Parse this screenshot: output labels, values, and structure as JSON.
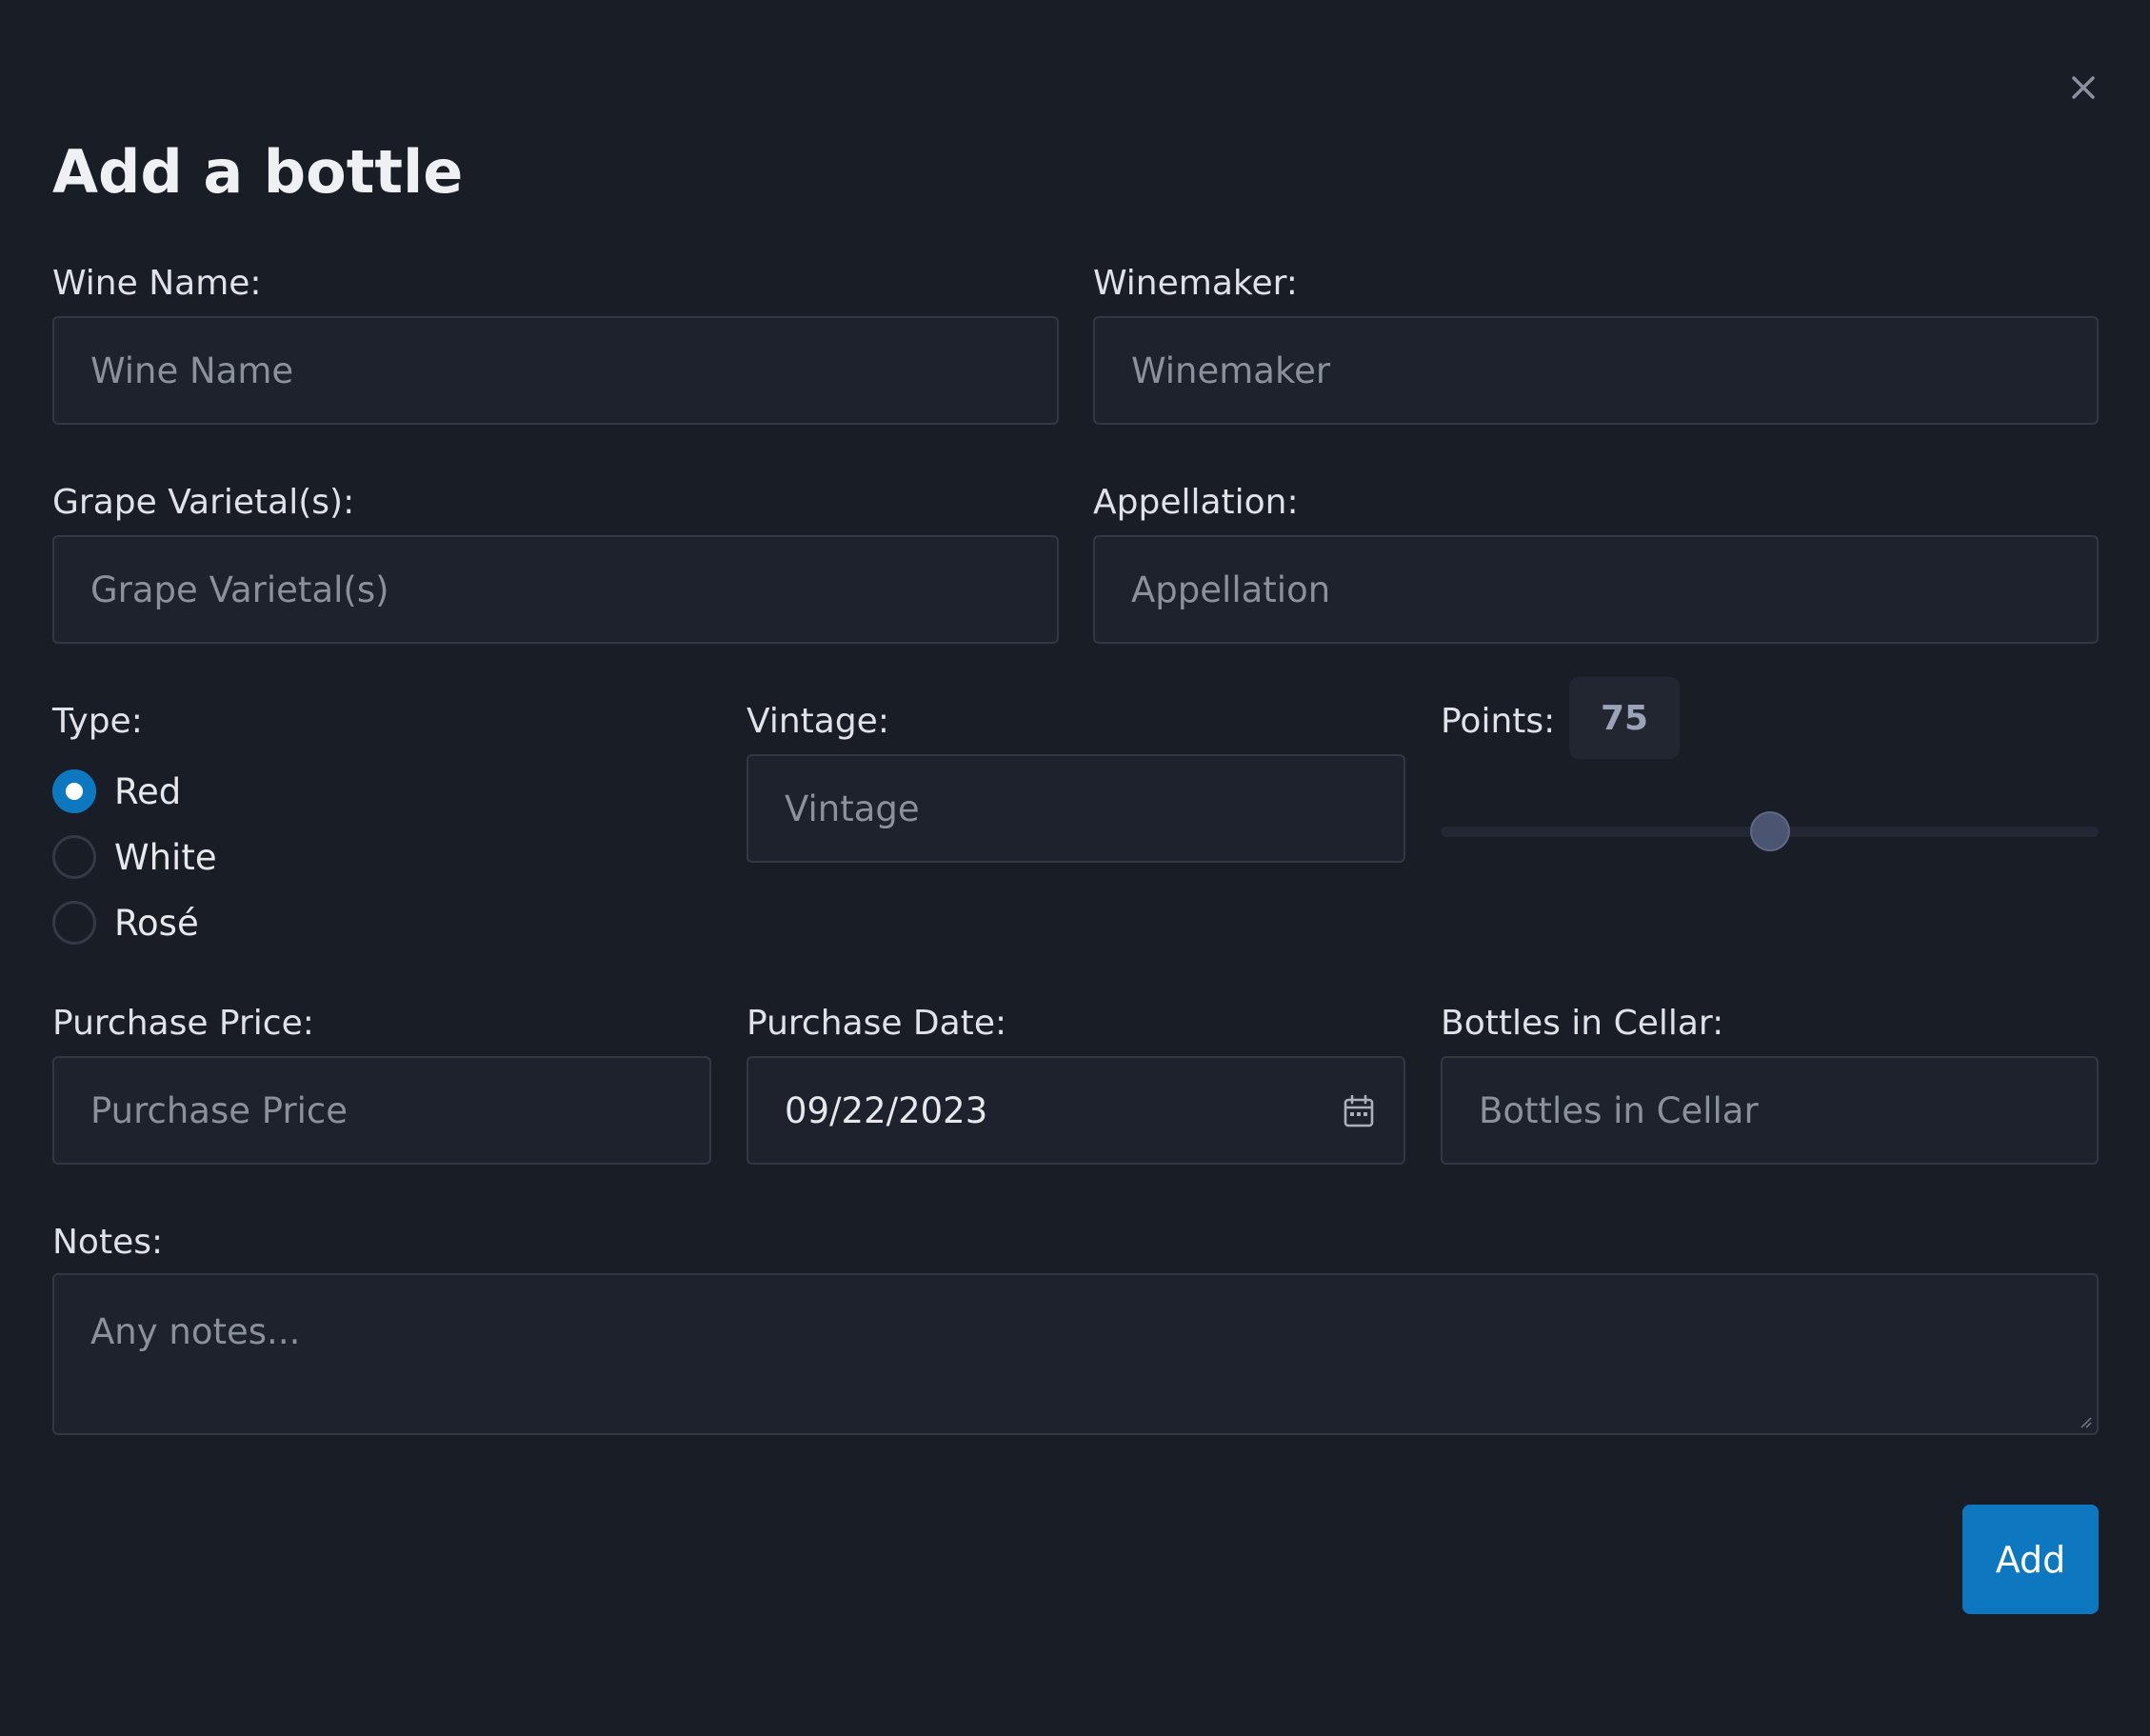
{
  "modal": {
    "title": "Add a bottle",
    "close_icon": "close-icon"
  },
  "form": {
    "wine_name": {
      "label": "Wine Name:",
      "placeholder": "Wine Name",
      "value": ""
    },
    "winemaker": {
      "label": "Winemaker:",
      "placeholder": "Winemaker",
      "value": ""
    },
    "grape_varietals": {
      "label": "Grape Varietal(s):",
      "placeholder": "Grape Varietal(s)",
      "value": ""
    },
    "appellation": {
      "label": "Appellation:",
      "placeholder": "Appellation",
      "value": ""
    },
    "type": {
      "label": "Type:",
      "options": [
        "Red",
        "White",
        "Rosé"
      ],
      "selected": "Red"
    },
    "vintage": {
      "label": "Vintage:",
      "placeholder": "Vintage",
      "value": ""
    },
    "points": {
      "label": "Points:",
      "value": "75",
      "min": 50,
      "max": 100
    },
    "purchase_price": {
      "label": "Purchase Price:",
      "placeholder": "Purchase Price",
      "value": ""
    },
    "purchase_date": {
      "label": "Purchase Date:",
      "value": "09/22/2023",
      "icon": "calendar-icon"
    },
    "bottles_in_cellar": {
      "label": "Bottles in Cellar:",
      "placeholder": "Bottles in Cellar",
      "value": ""
    },
    "notes": {
      "label": "Notes:",
      "placeholder": "Any notes...",
      "value": ""
    }
  },
  "actions": {
    "add_label": "Add"
  },
  "colors": {
    "background": "#191d26",
    "field_background": "#1e222c",
    "accent": "#0d78c0"
  }
}
